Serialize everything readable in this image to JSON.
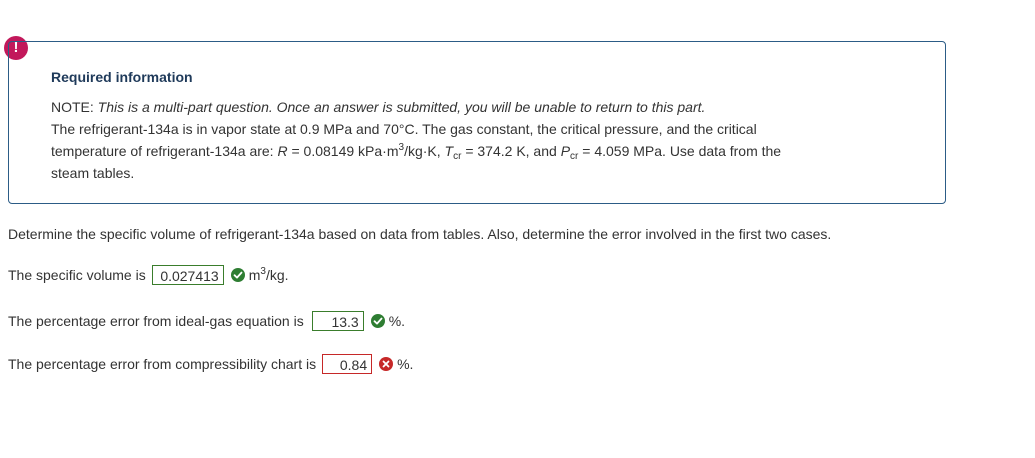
{
  "alert": {
    "symbol": "!"
  },
  "info": {
    "title": "Required information",
    "note_label": "NOTE:",
    "note_text": "This is a multi-part question. Once an answer is submitted, you will be unable to return to this part.",
    "line2": "The refrigerant-134a is in vapor state at 0.9 MPa and 70°C. The gas constant, the critical pressure, and the critical",
    "line3_a": "temperature of refrigerant-134a are: ",
    "line3_R": "R",
    "line3_b": " = 0.08149 kPa·m",
    "line3_exp": "3",
    "line3_c": "/kg·K, ",
    "line3_T": "T",
    "line3_Tsub": "cr",
    "line3_d": " = 374.2 K, and ",
    "line3_P": "P",
    "line3_Psub": "cr",
    "line3_e": " = 4.059 MPa. Use data from the",
    "line4": "steam tables."
  },
  "question": "Determine the specific volume of refrigerant-134a based on data from tables. Also, determine the error involved in the first two cases.",
  "answers": [
    {
      "prefix": "The specific volume is",
      "value": "0.027413",
      "status": "correct",
      "unit": "m",
      "unit_exp": "3",
      "unit_tail": "/kg."
    },
    {
      "prefix": "The percentage error from ideal-gas equation is",
      "value": "13.3",
      "status": "correct",
      "unit": "%."
    },
    {
      "prefix": "The percentage error from compressibility chart is",
      "value": "0.84",
      "status": "incorrect",
      "unit": "%."
    }
  ],
  "colors": {
    "correct": "#2e7d32",
    "incorrect": "#c62828",
    "alert": "#c2185b",
    "box_border": "#2c5c86"
  }
}
